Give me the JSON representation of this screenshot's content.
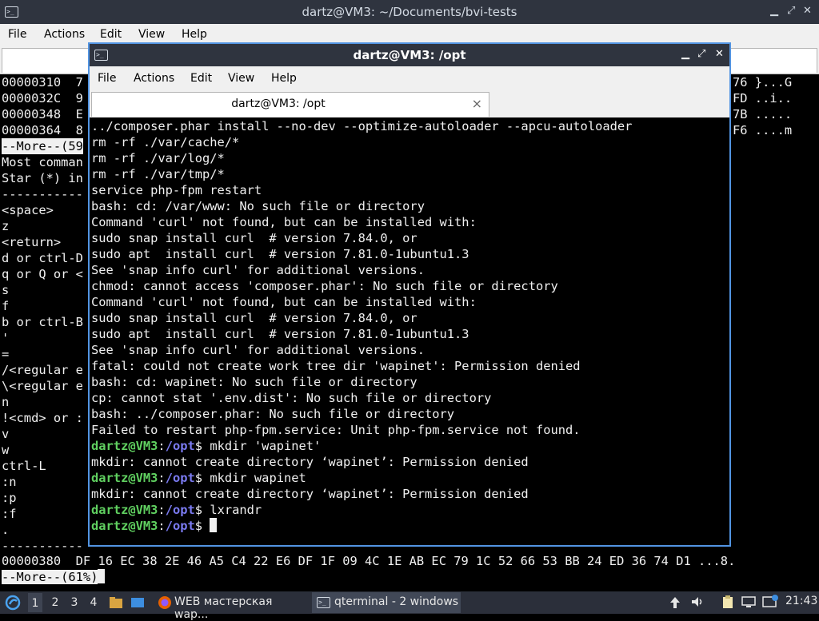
{
  "back_window": {
    "title": "dartz@VM3: ~/Documents/bvi-tests",
    "menu": [
      "File",
      "Actions",
      "Edit",
      "View",
      "Help"
    ],
    "terminal_lines": [
      "00000310  7",
      "0000032C  9",
      "00000348  E",
      "00000364  8",
      "--More--(59",
      "Most comman",
      "Star (*) in",
      "-----------",
      "<space>",
      "z",
      "<return>",
      "d or ctrl-D",
      "q or Q or <",
      "s",
      "f",
      "b or ctrl-B",
      "'",
      "=",
      "/<regular e",
      "\\<regular e",
      "n",
      "!<cmd> or :",
      "v",
      "w",
      "ctrl-L",
      ":n",
      ":p",
      ":f",
      ".",
      "-----------"
    ],
    "right_fragments": [
      "76 }...G",
      "FD ..i..",
      "7B .....",
      "F6 ....m"
    ],
    "hex_line": "00000380  DF 16 EC 38 2E 46 A5 C4 22 E6 DF 1F 09 4C 1E AB EC 79 1C 52 66 53 BB 24 ED 36 74 D1 ...8.",
    "more_prompt": "--More--(61%)"
  },
  "front_window": {
    "title": "dartz@VM3: /opt",
    "menu": [
      "File",
      "Actions",
      "Edit",
      "View",
      "Help"
    ],
    "tab_label": "dartz@VM3: /opt",
    "tab_close": "×",
    "output_lines": [
      "../composer.phar install --no-dev --optimize-autoloader --apcu-autoloader",
      "rm -rf ./var/cache/*",
      "rm -rf ./var/log/*",
      "rm -rf ./var/tmp/*",
      "service php-fpm restart",
      "bash: cd: /var/www: No such file or directory",
      "Command 'curl' not found, but can be installed with:",
      "sudo snap install curl  # version 7.84.0, or",
      "sudo apt  install curl  # version 7.81.0-1ubuntu1.3",
      "See 'snap info curl' for additional versions.",
      "chmod: cannot access 'composer.phar': No such file or directory",
      "Command 'curl' not found, but can be installed with:",
      "sudo snap install curl  # version 7.84.0, or",
      "sudo apt  install curl  # version 7.81.0-1ubuntu1.3",
      "See 'snap info curl' for additional versions.",
      "fatal: could not create work tree dir 'wapinet': Permission denied",
      "bash: cd: wapinet: No such file or directory",
      "cp: cannot stat '.env.dist': No such file or directory",
      "bash: ../composer.phar: No such file or directory",
      "Failed to restart php-fpm.service: Unit php-fpm.service not found."
    ],
    "prompt": {
      "user": "dartz@VM3",
      "sep": ":",
      "path": "/opt",
      "symbol": "$"
    },
    "session": [
      {
        "cmd": " mkdir 'wapinet'",
        "output": "mkdir: cannot create directory ‘wapinet’: Permission denied"
      },
      {
        "cmd": " mkdir wapinet",
        "output": "mkdir: cannot create directory ‘wapinet’: Permission denied"
      },
      {
        "cmd": " lxrandr"
      }
    ]
  },
  "taskbar": {
    "workspaces": [
      "1",
      "2",
      "3",
      "4"
    ],
    "active_workspace": "1",
    "tasks": [
      {
        "label": "WEB мастерская wap...",
        "icon": "firefox-icon"
      },
      {
        "label": "qterminal - 2 windows",
        "icon": "terminal-icon"
      }
    ],
    "clock": "21:43"
  },
  "colors": {
    "title_bar": "#2f343f",
    "focus_border": "#5294e2",
    "prompt_user": "#60d060",
    "prompt_path": "#7a7af0",
    "taskbar": "#2b2f3a"
  }
}
